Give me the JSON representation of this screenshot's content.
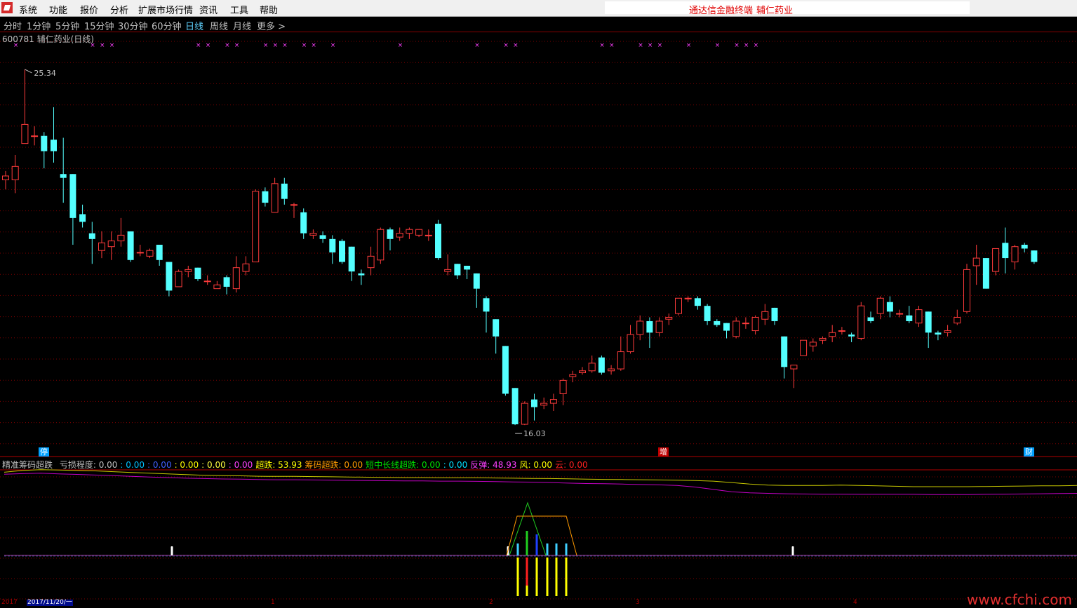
{
  "menu": {
    "items": [
      "系统",
      "功能",
      "报价",
      "分析",
      "扩展市场行情",
      "资讯",
      "工具",
      "帮助"
    ],
    "title_left": "通达信金融终端",
    "title_right": "辅仁药业"
  },
  "periods": {
    "items": [
      "分时",
      "1分钟",
      "5分钟",
      "15分钟",
      "30分钟",
      "60分钟",
      "日线",
      "周线",
      "月线",
      "更多 >"
    ],
    "active": "日线"
  },
  "stock": {
    "title": "600781 辅仁药业(日线)",
    "high_label": "25.34",
    "low_label": "16.03"
  },
  "events": [
    {
      "label": "停",
      "color": "#00a0ff"
    },
    {
      "label": "增",
      "color": "#c00000"
    },
    {
      "label": "财",
      "color": "#00a0ff"
    }
  ],
  "indicator": {
    "name": "精准筹码超跌",
    "items": [
      {
        "text": "亏损程度: 0.00",
        "color": "#c0c0c0"
      },
      {
        "text": ": 0.00",
        "color": "#00c0ff"
      },
      {
        "text": ": 0.00",
        "color": "#4060ff"
      },
      {
        "text": ": 0.00",
        "color": "#ffff00"
      },
      {
        "text": ": 0.00",
        "color": "#ffff40"
      },
      {
        "text": ": 0.00",
        "color": "#ff40ff"
      },
      {
        "text": "超跌: 53.93",
        "color": "#ffff00"
      },
      {
        "text": "筹码超跌: 0.00",
        "color": "#ff9a00"
      },
      {
        "text": "短中长线超跌: 0.00",
        "color": "#00e000"
      },
      {
        "text": ": 0.00",
        "color": "#00e0ff"
      },
      {
        "text": "反弹: 48.93",
        "color": "#ff40ff"
      },
      {
        "text": "风: 0.00",
        "color": "#ffff00"
      },
      {
        "text": "云: 0.00",
        "color": "#ff2020"
      }
    ]
  },
  "dates": {
    "year": "2017",
    "current": "2017/11/20/一",
    "ticks": [
      "1",
      "2",
      "3",
      "4"
    ]
  },
  "watermark": "www.cfchi.com",
  "colors": {
    "up": "#ff3b3b",
    "down": "#54ffff",
    "grid": "#800000",
    "cross": "#ff40ff"
  },
  "chart_data": {
    "type": "candlestick",
    "y_range": [
      15.5,
      26.0
    ],
    "max_price": 25.34,
    "min_price": 16.03,
    "candles": [
      {
        "o": 22.45,
        "c": 22.55,
        "h": 22.68,
        "l": 22.2
      },
      {
        "o": 22.45,
        "c": 22.8,
        "h": 23.1,
        "l": 22.1
      },
      {
        "o": 23.4,
        "c": 23.9,
        "h": 25.34,
        "l": 23.4
      },
      {
        "o": 23.6,
        "c": 23.6,
        "h": 23.85,
        "l": 23.35
      },
      {
        "o": 23.6,
        "c": 23.2,
        "h": 23.7,
        "l": 22.75
      },
      {
        "o": 23.5,
        "c": 23.2,
        "h": 24.35,
        "l": 22.9
      },
      {
        "o": 22.6,
        "c": 22.5,
        "h": 23.55,
        "l": 21.85
      },
      {
        "o": 22.6,
        "c": 21.45,
        "h": 22.6,
        "l": 20.75
      },
      {
        "o": 21.55,
        "c": 21.35,
        "h": 21.8,
        "l": 21.2
      },
      {
        "o": 21.05,
        "c": 20.9,
        "h": 21.35,
        "l": 20.25
      },
      {
        "o": 20.6,
        "c": 20.8,
        "h": 21.1,
        "l": 20.4
      },
      {
        "o": 20.7,
        "c": 20.85,
        "h": 21.1,
        "l": 20.35
      },
      {
        "o": 20.85,
        "c": 21.0,
        "h": 21.45,
        "l": 20.7
      },
      {
        "o": 21.1,
        "c": 20.35,
        "h": 21.1,
        "l": 20.3
      },
      {
        "o": 20.55,
        "c": 20.55,
        "h": 20.75,
        "l": 20.45
      },
      {
        "o": 20.45,
        "c": 20.6,
        "h": 20.65,
        "l": 20.4
      },
      {
        "o": 20.75,
        "c": 20.35,
        "h": 20.75,
        "l": 20.2
      },
      {
        "o": 20.3,
        "c": 19.55,
        "h": 20.3,
        "l": 19.4
      },
      {
        "o": 19.65,
        "c": 20.05,
        "h": 20.1,
        "l": 19.65
      },
      {
        "o": 20.05,
        "c": 20.1,
        "h": 20.2,
        "l": 19.9
      },
      {
        "o": 20.15,
        "c": 19.85,
        "h": 20.15,
        "l": 19.8
      },
      {
        "o": 19.8,
        "c": 19.8,
        "h": 19.95,
        "l": 19.7
      },
      {
        "o": 19.6,
        "c": 19.7,
        "h": 19.8,
        "l": 19.6
      },
      {
        "o": 19.9,
        "c": 19.65,
        "h": 19.95,
        "l": 19.45
      },
      {
        "o": 19.6,
        "c": 20.15,
        "h": 20.45,
        "l": 19.5
      },
      {
        "o": 20.05,
        "c": 20.25,
        "h": 20.45,
        "l": 19.95
      },
      {
        "o": 20.3,
        "c": 22.15,
        "h": 22.2,
        "l": 20.3
      },
      {
        "o": 22.15,
        "c": 21.85,
        "h": 22.25,
        "l": 21.75
      },
      {
        "o": 21.6,
        "c": 22.35,
        "h": 22.5,
        "l": 21.6
      },
      {
        "o": 22.35,
        "c": 21.95,
        "h": 22.5,
        "l": 21.8
      },
      {
        "o": 21.8,
        "c": 21.8,
        "h": 21.85,
        "l": 21.45
      },
      {
        "o": 21.6,
        "c": 21.05,
        "h": 21.7,
        "l": 20.9
      },
      {
        "o": 21.0,
        "c": 21.05,
        "h": 21.15,
        "l": 20.9
      },
      {
        "o": 21.0,
        "c": 20.9,
        "h": 21.1,
        "l": 20.8
      },
      {
        "o": 20.9,
        "c": 20.55,
        "h": 21.0,
        "l": 20.25
      },
      {
        "o": 20.85,
        "c": 20.3,
        "h": 20.9,
        "l": 20.25
      },
      {
        "o": 20.7,
        "c": 20.05,
        "h": 20.7,
        "l": 19.8
      },
      {
        "o": 20.0,
        "c": 19.95,
        "h": 20.1,
        "l": 19.7
      },
      {
        "o": 20.15,
        "c": 20.45,
        "h": 20.7,
        "l": 19.95
      },
      {
        "o": 20.35,
        "c": 21.15,
        "h": 21.2,
        "l": 20.25
      },
      {
        "o": 21.15,
        "c": 20.9,
        "h": 21.2,
        "l": 20.6
      },
      {
        "o": 20.95,
        "c": 21.05,
        "h": 21.2,
        "l": 20.85
      },
      {
        "o": 21.05,
        "c": 21.15,
        "h": 21.2,
        "l": 20.9
      },
      {
        "o": 21.0,
        "c": 21.15,
        "h": 21.15,
        "l": 20.95
      },
      {
        "o": 21.0,
        "c": 21.0,
        "h": 21.15,
        "l": 20.85
      },
      {
        "o": 21.3,
        "c": 20.4,
        "h": 21.4,
        "l": 20.35
      },
      {
        "o": 20.05,
        "c": 20.1,
        "h": 20.5,
        "l": 19.95
      },
      {
        "o": 20.25,
        "c": 19.95,
        "h": 20.25,
        "l": 19.85
      },
      {
        "o": 20.2,
        "c": 20.1,
        "h": 20.2,
        "l": 19.85
      },
      {
        "o": 20.0,
        "c": 19.6,
        "h": 20.0,
        "l": 19.1
      },
      {
        "o": 19.35,
        "c": 19.0,
        "h": 19.4,
        "l": 18.45
      },
      {
        "o": 18.8,
        "c": 18.35,
        "h": 18.8,
        "l": 17.9
      },
      {
        "o": 18.1,
        "c": 16.85,
        "h": 18.1,
        "l": 16.8
      },
      {
        "o": 17.0,
        "c": 16.05,
        "h": 17.0,
        "l": 16.03
      },
      {
        "o": 16.05,
        "c": 16.6,
        "h": 16.65,
        "l": 16.03
      },
      {
        "o": 16.7,
        "c": 16.5,
        "h": 16.85,
        "l": 16.15
      },
      {
        "o": 16.55,
        "c": 16.6,
        "h": 16.75,
        "l": 16.45
      },
      {
        "o": 16.6,
        "c": 16.7,
        "h": 16.85,
        "l": 16.4
      },
      {
        "o": 16.85,
        "c": 17.2,
        "h": 17.25,
        "l": 16.55
      },
      {
        "o": 17.3,
        "c": 17.35,
        "h": 17.45,
        "l": 17.15
      },
      {
        "o": 17.4,
        "c": 17.45,
        "h": 17.55,
        "l": 17.35
      },
      {
        "o": 17.45,
        "c": 17.65,
        "h": 17.85,
        "l": 17.4
      },
      {
        "o": 17.8,
        "c": 17.4,
        "h": 17.85,
        "l": 17.35
      },
      {
        "o": 17.45,
        "c": 17.5,
        "h": 17.6,
        "l": 17.35
      },
      {
        "o": 17.5,
        "c": 17.95,
        "h": 18.35,
        "l": 17.45
      },
      {
        "o": 17.95,
        "c": 18.4,
        "h": 18.65,
        "l": 17.9
      },
      {
        "o": 18.4,
        "c": 18.75,
        "h": 18.9,
        "l": 18.25
      },
      {
        "o": 18.75,
        "c": 18.45,
        "h": 18.85,
        "l": 18.05
      },
      {
        "o": 18.45,
        "c": 18.75,
        "h": 18.85,
        "l": 18.35
      },
      {
        "o": 18.8,
        "c": 18.85,
        "h": 18.95,
        "l": 18.65
      },
      {
        "o": 18.95,
        "c": 19.35,
        "h": 19.35,
        "l": 18.9
      },
      {
        "o": 19.35,
        "c": 19.35,
        "h": 19.4,
        "l": 19.25
      },
      {
        "o": 19.35,
        "c": 19.15,
        "h": 19.4,
        "l": 19.05
      },
      {
        "o": 19.15,
        "c": 18.75,
        "h": 19.2,
        "l": 18.65
      },
      {
        "o": 18.75,
        "c": 18.65,
        "h": 18.8,
        "l": 18.6
      },
      {
        "o": 18.7,
        "c": 18.5,
        "h": 18.7,
        "l": 18.3
      },
      {
        "o": 18.35,
        "c": 18.75,
        "h": 18.85,
        "l": 18.3
      },
      {
        "o": 18.7,
        "c": 18.7,
        "h": 18.85,
        "l": 18.55
      },
      {
        "o": 18.5,
        "c": 18.85,
        "h": 18.9,
        "l": 18.4
      },
      {
        "o": 18.8,
        "c": 19.0,
        "h": 19.2,
        "l": 18.65
      },
      {
        "o": 19.1,
        "c": 18.75,
        "h": 19.1,
        "l": 18.65
      },
      {
        "o": 18.35,
        "c": 17.55,
        "h": 18.35,
        "l": 17.25
      },
      {
        "o": 17.5,
        "c": 17.6,
        "h": 17.6,
        "l": 17.0
      },
      {
        "o": 17.85,
        "c": 18.25,
        "h": 18.25,
        "l": 17.85
      },
      {
        "o": 18.1,
        "c": 18.2,
        "h": 18.3,
        "l": 17.95
      },
      {
        "o": 18.25,
        "c": 18.3,
        "h": 18.35,
        "l": 18.15
      },
      {
        "o": 18.35,
        "c": 18.45,
        "h": 18.65,
        "l": 18.2
      },
      {
        "o": 18.5,
        "c": 18.5,
        "h": 18.6,
        "l": 18.4
      },
      {
        "o": 18.4,
        "c": 18.35,
        "h": 18.45,
        "l": 18.2
      },
      {
        "o": 18.3,
        "c": 19.15,
        "h": 19.25,
        "l": 18.25
      },
      {
        "o": 18.85,
        "c": 18.75,
        "h": 19.0,
        "l": 18.7
      },
      {
        "o": 18.95,
        "c": 19.35,
        "h": 19.4,
        "l": 18.8
      },
      {
        "o": 19.25,
        "c": 19.0,
        "h": 19.4,
        "l": 18.85
      },
      {
        "o": 18.95,
        "c": 18.95,
        "h": 19.05,
        "l": 18.85
      },
      {
        "o": 18.9,
        "c": 18.75,
        "h": 19.15,
        "l": 18.7
      },
      {
        "o": 18.7,
        "c": 19.05,
        "h": 19.15,
        "l": 18.6
      },
      {
        "o": 19.0,
        "c": 18.45,
        "h": 19.0,
        "l": 18.05
      },
      {
        "o": 18.45,
        "c": 18.4,
        "h": 18.5,
        "l": 18.25
      },
      {
        "o": 18.45,
        "c": 18.5,
        "h": 18.65,
        "l": 18.35
      },
      {
        "o": 18.7,
        "c": 18.85,
        "h": 19.05,
        "l": 18.65
      },
      {
        "o": 19.0,
        "c": 20.1,
        "h": 20.25,
        "l": 18.95
      },
      {
        "o": 20.2,
        "c": 20.4,
        "h": 20.75,
        "l": 19.7
      },
      {
        "o": 20.4,
        "c": 19.6,
        "h": 20.4,
        "l": 19.6
      },
      {
        "o": 20.05,
        "c": 20.65,
        "h": 20.65,
        "l": 19.95
      },
      {
        "o": 20.8,
        "c": 20.4,
        "h": 21.2,
        "l": 20.0
      },
      {
        "o": 20.3,
        "c": 20.7,
        "h": 20.75,
        "l": 20.1
      },
      {
        "o": 20.75,
        "c": 20.65,
        "h": 20.8,
        "l": 20.55
      },
      {
        "o": 20.6,
        "c": 20.3,
        "h": 20.6,
        "l": 20.25
      }
    ],
    "markers": [
      1,
      9,
      10,
      11,
      20,
      21,
      23,
      24,
      27,
      28,
      29,
      31,
      32,
      34,
      41,
      49,
      52,
      53,
      62,
      63,
      66,
      67,
      68,
      71,
      74,
      76,
      77,
      78
    ]
  },
  "indicator_data": {
    "type": "line",
    "series": [
      {
        "name": "超跌",
        "color": "#c8c800",
        "values": [
          53.0,
          53.9,
          54.3,
          54.1,
          53.9,
          53.7,
          53.3,
          52.9,
          52.5,
          52.2,
          51.8,
          51.5,
          51.3,
          51.2,
          51.0,
          50.9,
          50.9,
          50.8,
          50.7,
          50.6,
          50.5,
          50.4,
          50.3,
          50.3,
          50.2,
          50.2,
          50.2,
          50.1,
          50.0,
          49.9,
          49.8,
          49.7,
          49.5,
          49.4,
          49.3,
          49.2,
          49.1,
          49.0,
          48.8,
          48.5,
          47.8,
          47.0,
          46.5,
          46.3,
          46.3,
          46.3,
          46.5,
          46.3,
          46.1,
          45.9,
          45.7,
          45.7,
          45.7,
          45.7,
          45.8,
          45.9,
          46.0,
          46.1,
          46.1,
          46.3
        ]
      },
      {
        "name": "反弹",
        "color": "#c000c0",
        "values": [
          52.0,
          52.3,
          52.5,
          52.2,
          51.9,
          51.6,
          51.3,
          50.9,
          50.6,
          50.3,
          50.0,
          49.8,
          49.6,
          49.5,
          49.3,
          49.2,
          49.2,
          49.1,
          49.0,
          48.9,
          48.8,
          48.7,
          48.6,
          48.6,
          48.5,
          48.5,
          48.4,
          48.3,
          48.1,
          48.0,
          47.8,
          47.5,
          47.3,
          47.2,
          47.0,
          46.8,
          46.6,
          46.3,
          45.5,
          44.3,
          43.1,
          42.6,
          42.3,
          42.1,
          42.0,
          41.9,
          41.9,
          41.8,
          41.8,
          41.8,
          41.8,
          41.7,
          41.7,
          41.7,
          41.8,
          41.9,
          42.0,
          42.1,
          42.2,
          42.3
        ]
      }
    ]
  }
}
